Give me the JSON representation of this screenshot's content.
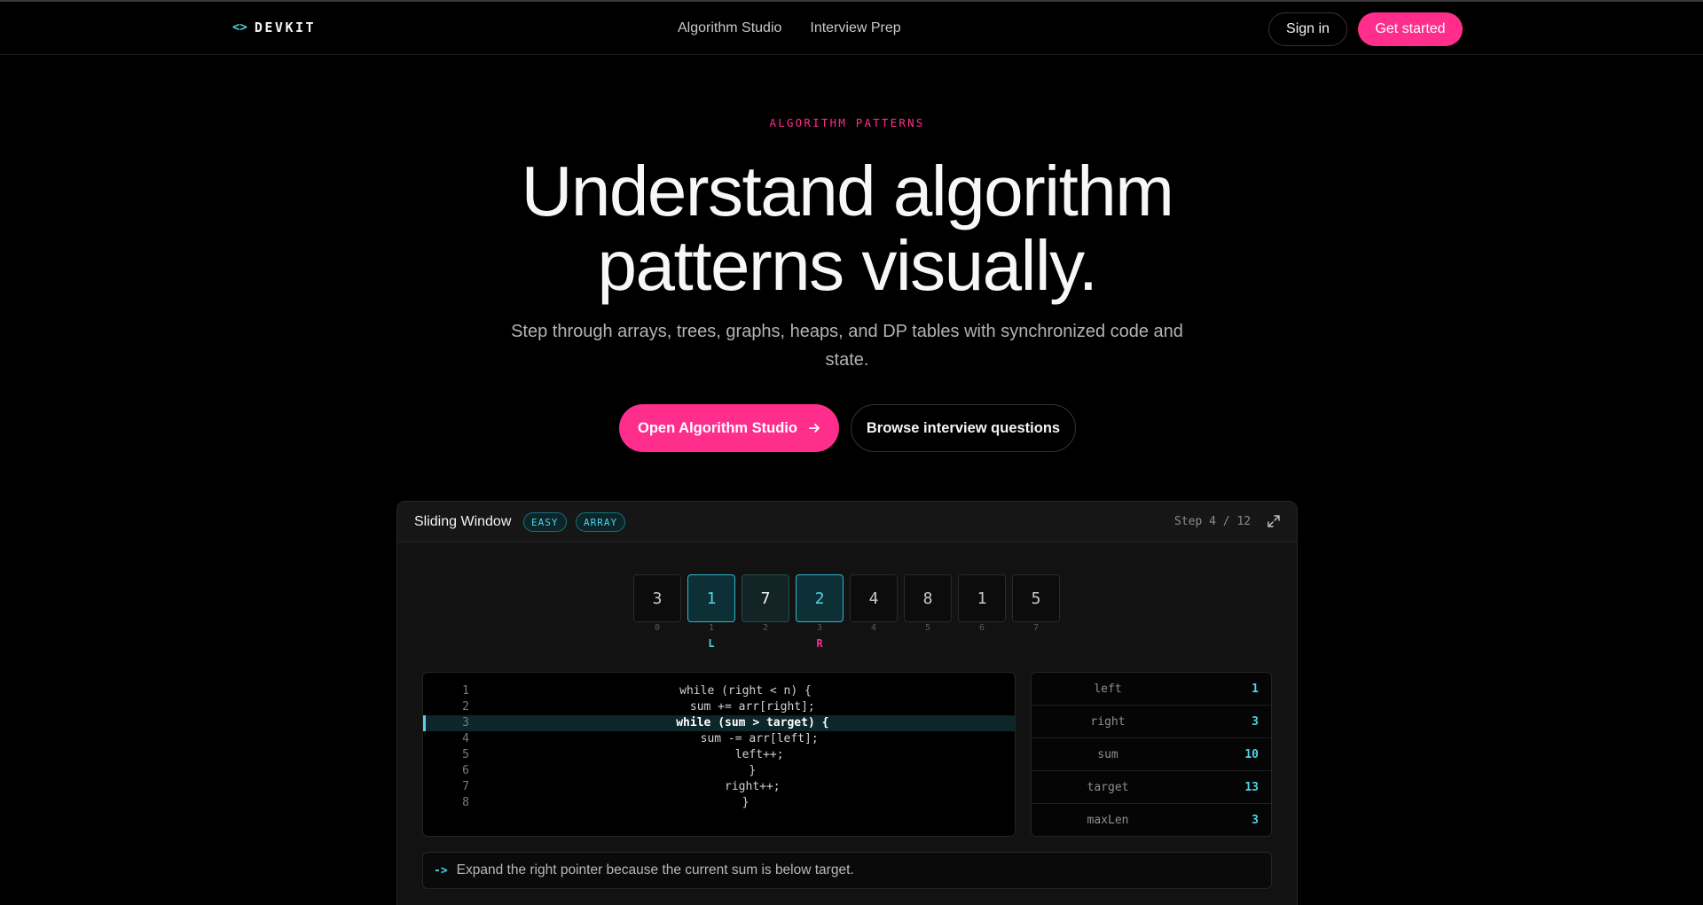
{
  "nav": {
    "logo_icon": "<>",
    "logo_text": "DEVKIT",
    "links": [
      {
        "label": "Algorithm Studio"
      },
      {
        "label": "Interview Prep"
      }
    ],
    "signin_label": "Sign in",
    "getstarted_label": "Get started"
  },
  "hero": {
    "eyebrow": "ALGORITHM PATTERNS",
    "headline_line1": "Understand algorithm",
    "headline_line2": "patterns visually.",
    "subtitle": "Step through arrays, trees, graphs, heaps, and DP tables with synchronized code and state.",
    "primary_cta": "Open Algorithm Studio",
    "primary_cta_icon": "arrow-right-icon",
    "secondary_cta": "Browse interview questions"
  },
  "studio": {
    "title": "Sliding Window",
    "badges": [
      "EASY",
      "ARRAY"
    ],
    "step_label": "Step 4 / 12",
    "expand_icon": "expand-icon",
    "array": [
      {
        "value": "3",
        "index": "0",
        "pointer": "",
        "state": "normal"
      },
      {
        "value": "1",
        "index": "1",
        "pointer": "L",
        "state": "pointer"
      },
      {
        "value": "7",
        "index": "2",
        "pointer": "",
        "state": "window"
      },
      {
        "value": "2",
        "index": "3",
        "pointer": "R",
        "state": "pointer"
      },
      {
        "value": "4",
        "index": "4",
        "pointer": "",
        "state": "normal"
      },
      {
        "value": "8",
        "index": "5",
        "pointer": "",
        "state": "normal"
      },
      {
        "value": "1",
        "index": "6",
        "pointer": "",
        "state": "normal"
      },
      {
        "value": "5",
        "index": "7",
        "pointer": "",
        "state": "normal"
      }
    ],
    "code": [
      {
        "n": "1",
        "text": "while (right < n) {"
      },
      {
        "n": "2",
        "text": "  sum += arr[right];"
      },
      {
        "n": "3",
        "text": "  while (sum > target) {"
      },
      {
        "n": "4",
        "text": "    sum -= arr[left];"
      },
      {
        "n": "5",
        "text": "    left++;"
      },
      {
        "n": "6",
        "text": "  }"
      },
      {
        "n": "7",
        "text": "  right++;"
      },
      {
        "n": "8",
        "text": "}"
      }
    ],
    "active_line": 3,
    "vars": [
      {
        "name": "left",
        "value": "1"
      },
      {
        "name": "right",
        "value": "3"
      },
      {
        "name": "sum",
        "value": "10"
      },
      {
        "name": "target",
        "value": "13"
      },
      {
        "name": "maxLen",
        "value": "3"
      }
    ],
    "explain_arrow": "->",
    "explanation": "Expand the right pointer because the current sum is below target."
  },
  "colors": {
    "accent_pink": "#ff2e8d",
    "accent_cyan": "#4fd3e8",
    "background": "#000000"
  }
}
